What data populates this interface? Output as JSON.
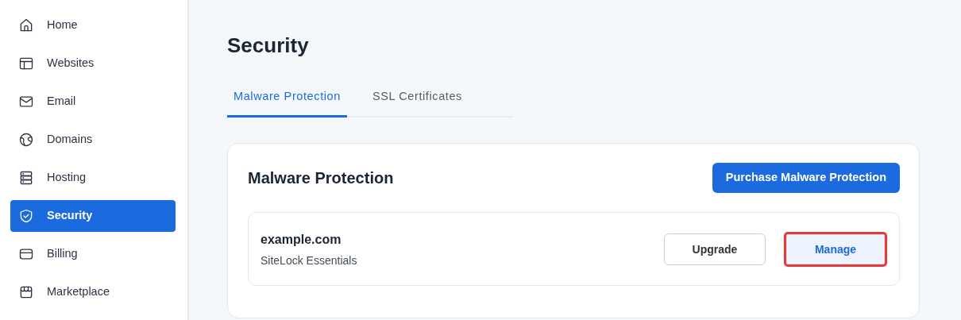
{
  "sidebar": {
    "items": [
      {
        "label": "Home",
        "kind": "home",
        "selected": false
      },
      {
        "label": "Websites",
        "kind": "layout",
        "selected": false
      },
      {
        "label": "Email",
        "kind": "mail",
        "selected": false
      },
      {
        "label": "Domains",
        "kind": "globe",
        "selected": false
      },
      {
        "label": "Hosting",
        "kind": "server",
        "selected": false
      },
      {
        "label": "Security",
        "kind": "shield",
        "selected": true
      },
      {
        "label": "Billing",
        "kind": "card",
        "selected": false
      },
      {
        "label": "Marketplace",
        "kind": "store",
        "selected": false
      }
    ]
  },
  "page": {
    "title": "Security"
  },
  "tabs": [
    {
      "label": "Malware Protection",
      "selected": true
    },
    {
      "label": "SSL Certificates",
      "selected": false
    }
  ],
  "panel": {
    "title": "Malware Protection",
    "action": "Purchase Malware Protection",
    "items": [
      {
        "domain": "example.com",
        "plan": "SiteLock Essentials",
        "buttons": [
          {
            "label": "Upgrade",
            "kind": "outline",
            "highlighted": false
          },
          {
            "label": "Manage",
            "kind": "soft",
            "highlighted": true
          }
        ]
      }
    ]
  }
}
